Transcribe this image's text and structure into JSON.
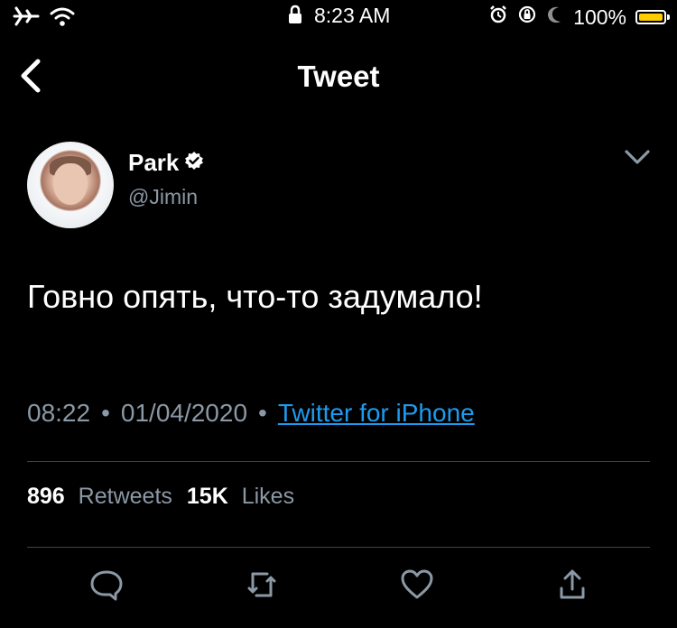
{
  "status_bar": {
    "time": "8:23 AM",
    "battery_percent_text": "100%",
    "battery_fill_fraction": 1.0,
    "icons": [
      "airplane-icon",
      "wifi-icon",
      "lock-icon",
      "alarm-icon",
      "rotation-lock-icon",
      "moon-icon",
      "battery-icon"
    ],
    "battery_color": "#ffcc00"
  },
  "nav": {
    "title": "Tweet"
  },
  "tweet": {
    "author_name": "Park",
    "handle": "@Jimin",
    "text": "Говно опять, что-то задумало!",
    "time": "08:22",
    "date": "01/04/2020",
    "source": "Twitter for iPhone",
    "retweets_count": "896",
    "retweets_label": "Retweets",
    "likes_count": "15K",
    "likes_label": "Likes",
    "verified": true
  },
  "colors": {
    "background": "#000000",
    "muted": "#8b98a5",
    "link": "#1d9bf0",
    "divider": "#38444d"
  }
}
